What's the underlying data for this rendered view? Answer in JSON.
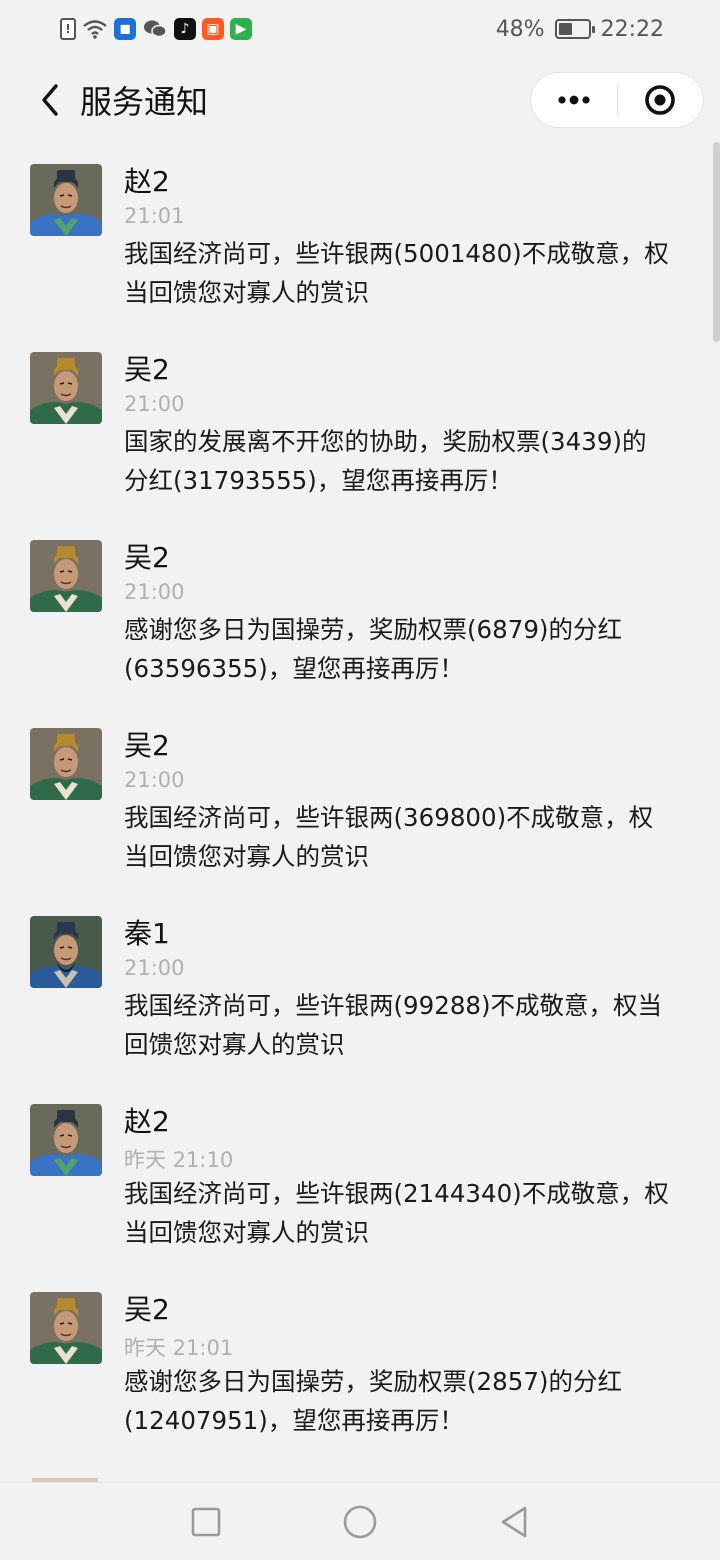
{
  "status_bar": {
    "battery": "48%",
    "battery_level": 0.48,
    "time": "22:22",
    "notification_icons": [
      "sim-alert-icon",
      "wifi-icon",
      "shield-app-icon",
      "wechat-icon",
      "tiktok-icon",
      "orange-app-icon",
      "video-app-icon"
    ]
  },
  "nav": {
    "title": "服务通知",
    "more_icon": "more-dots-icon",
    "close_icon": "target-close-icon"
  },
  "messages": [
    {
      "sender": "赵2",
      "time": "21:01",
      "text": "我国经济尚可，些许银两(5001480)不成敬意，权当回馈您对寡人的赏识",
      "avatar": "avatar-zhao"
    },
    {
      "sender": "吴2",
      "time": "21:00",
      "text": "国家的发展离不开您的协助，奖励权票(3439)的分红(31793555)，望您再接再厉！",
      "avatar": "avatar-wu"
    },
    {
      "sender": "吴2",
      "time": "21:00",
      "text": "感谢您多日为国操劳，奖励权票(6879)的分红(63596355)，望您再接再厉！",
      "avatar": "avatar-wu"
    },
    {
      "sender": "吴2",
      "time": "21:00",
      "text": "我国经济尚可，些许银两(369800)不成敬意，权当回馈您对寡人的赏识",
      "avatar": "avatar-wu"
    },
    {
      "sender": "秦1",
      "time": "21:00",
      "text": "我国经济尚可，些许银两(99288)不成敬意，权当回馈您对寡人的赏识",
      "avatar": "avatar-qin"
    },
    {
      "sender": "赵2",
      "time": "昨天 21:10",
      "text": "我国经济尚可，些许银两(2144340)不成敬意，权当回馈您对寡人的赏识",
      "avatar": "avatar-zhao"
    },
    {
      "sender": "吴2",
      "time": "昨天 21:01",
      "text": "感谢您多日为国操劳，奖励权票(2857)的分红(12407951)，望您再接再厉！",
      "avatar": "avatar-wu"
    }
  ],
  "system_nav": {
    "recents_icon": "square-recents-icon",
    "home_icon": "circle-home-icon",
    "back_icon": "triangle-back-icon"
  },
  "colors": {
    "background": "#f2f2f2",
    "time_text": "#b0b0b0",
    "avatar_zhao_robe": "#3a72c4",
    "avatar_wu_robe": "#2f6b4a",
    "avatar_qin_robe": "#2a5a9a"
  }
}
